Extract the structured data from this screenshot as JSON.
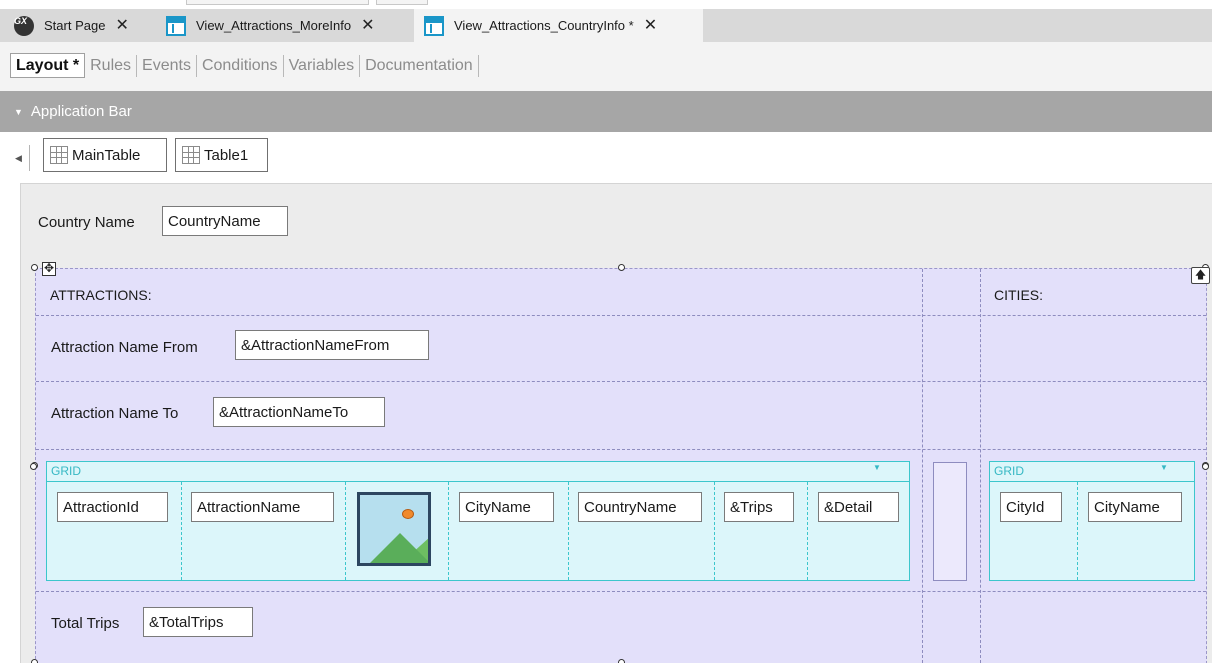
{
  "tabs": [
    {
      "label": "Start Page",
      "icon": "gx-logo-icon",
      "active": false
    },
    {
      "label": "View_Attractions_MoreInfo",
      "icon": "view-object-icon",
      "active": false
    },
    {
      "label": "View_Attractions_CountryInfo *",
      "icon": "view-object-icon",
      "active": true
    }
  ],
  "tab_close_glyph": "✕",
  "subtabs": [
    "Layout *",
    "Rules",
    "Events",
    "Conditions",
    "Variables",
    "Documentation"
  ],
  "app_bar": {
    "caret": "▼",
    "label": "Application Bar"
  },
  "breadcrumb": {
    "back_glyph": "◀",
    "items": [
      "MainTable",
      "Table1"
    ]
  },
  "form": {
    "country_name_label": "Country Name",
    "country_name_field": "CountryName",
    "attractions_header": "ATTRACTIONS:",
    "cities_header": "CITIES:",
    "attraction_from_label": "Attraction Name From",
    "attraction_from_field": "&AttractionNameFrom",
    "attraction_to_label": "Attraction Name To",
    "attraction_to_field": "&AttractionNameTo",
    "total_trips_label": "Total Trips",
    "total_trips_field": "&TotalTrips",
    "move_glyph": "✥",
    "up_glyph": "🡅"
  },
  "attractions_grid": {
    "title": "GRID",
    "caret": "▼",
    "columns": [
      "AttractionId",
      "AttractionName",
      "CityName",
      "CountryName",
      "&Trips",
      "&Detail"
    ]
  },
  "cities_grid": {
    "title": "GRID",
    "caret": "▼",
    "columns": [
      "CityId",
      "CityName"
    ]
  },
  "colors": {
    "tab_bar": "#d9d9d9",
    "app_bar": "#a6a6a6",
    "table_fill": "#e3e0fa",
    "grid_fill": "#dcf6fa",
    "grid_border": "#3cc6cc"
  }
}
